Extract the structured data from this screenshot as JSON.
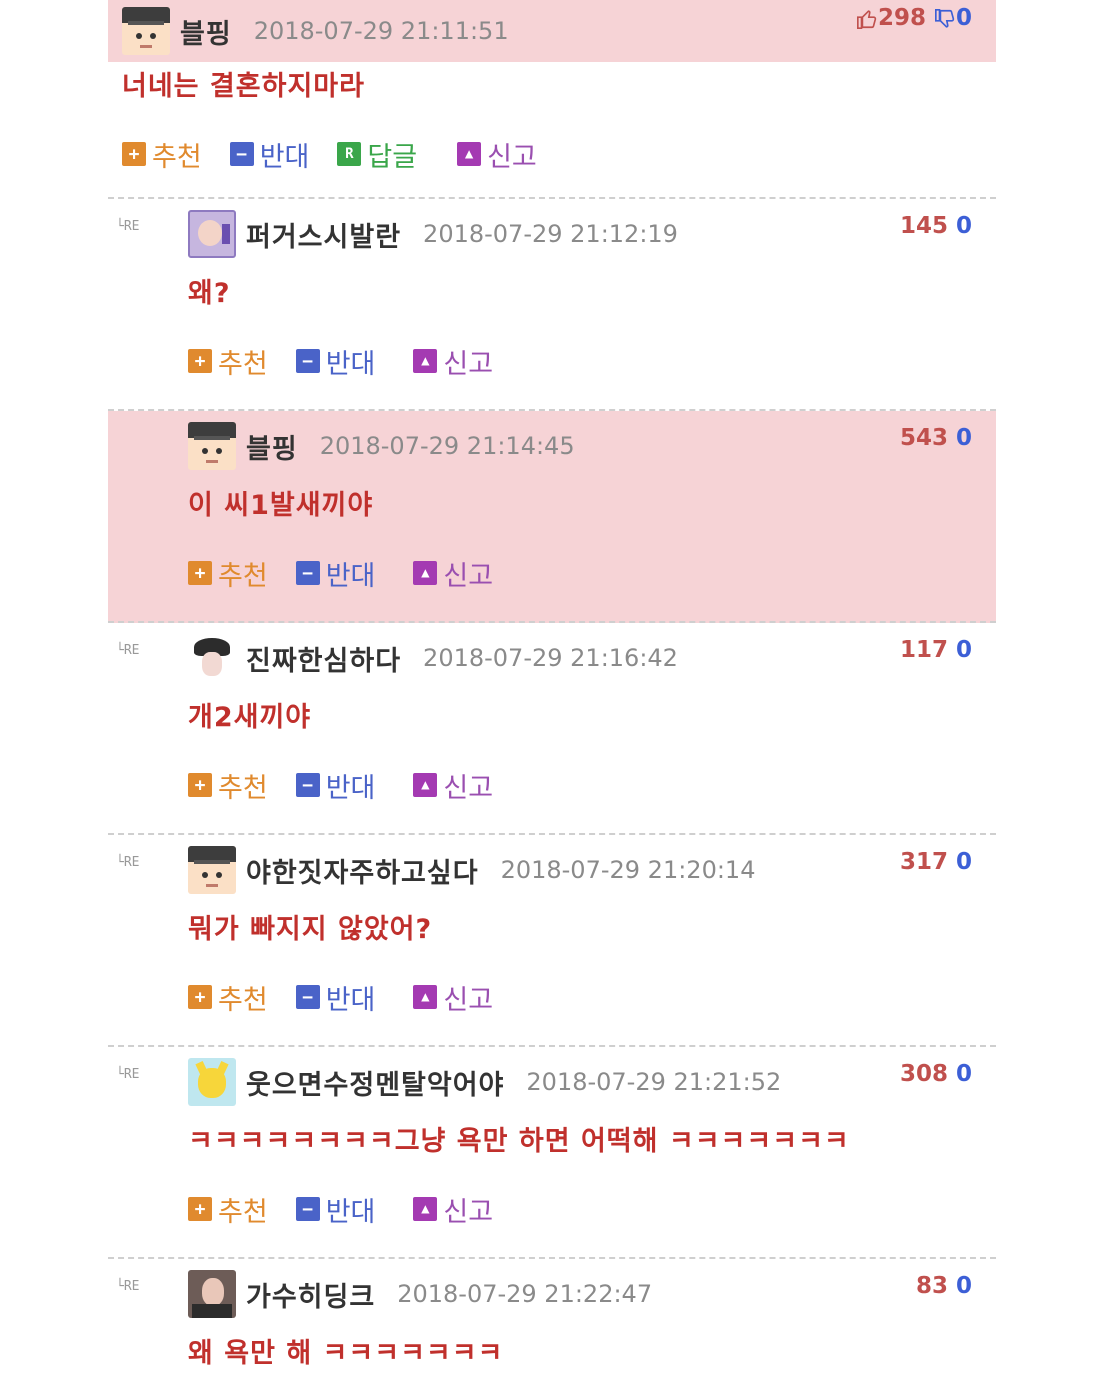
{
  "comments": [
    {
      "author": "블핑",
      "timestamp": "2018-07-29 21:11:51",
      "likes": "298",
      "dislikes": "0",
      "text": "너네는 결혼하지마라",
      "actions": {
        "up": "추천",
        "down": "반대",
        "reply": "답글",
        "report": "신고"
      },
      "reply_icon_glyph": "R",
      "avatar": "graduate-avatar"
    },
    {
      "re": "└RE",
      "author": "퍼거스시발란",
      "timestamp": "2018-07-29 21:12:19",
      "likes": "145",
      "dislikes": "0",
      "text": "왜?",
      "actions": {
        "up": "추천",
        "down": "반대",
        "report": "신고"
      }
    },
    {
      "re": "",
      "author": "블핑",
      "timestamp": "2018-07-29 21:14:45",
      "likes": "543",
      "dislikes": "0",
      "text": "이 씨1발새끼야",
      "actions": {
        "up": "추천",
        "down": "반대",
        "report": "신고"
      }
    },
    {
      "re": "└RE",
      "author": "진짜한심하다",
      "timestamp": "2018-07-29 21:16:42",
      "likes": "117",
      "dislikes": "0",
      "text": "개2새끼야",
      "actions": {
        "up": "추천",
        "down": "반대",
        "report": "신고"
      }
    },
    {
      "re": "└RE",
      "author": "야한짓자주하고싶다",
      "timestamp": "2018-07-29 21:20:14",
      "likes": "317",
      "dislikes": "0",
      "text": "뭐가 빠지지 않았어?",
      "actions": {
        "up": "추천",
        "down": "반대",
        "report": "신고"
      }
    },
    {
      "re": "└RE",
      "author": "웃으면수정멘탈악어야",
      "timestamp": "2018-07-29 21:21:52",
      "likes": "308",
      "dislikes": "0",
      "text": "ㅋㅋㅋㅋㅋㅋㅋㅋ그냥 욕만 하면 어떡해 ㅋㅋㅋㅋㅋㅋㅋ",
      "actions": {
        "up": "추천",
        "down": "반대",
        "report": "신고"
      }
    },
    {
      "re": "└RE",
      "author": "가수히딩크",
      "timestamp": "2018-07-29 21:22:47",
      "likes": "83",
      "dislikes": "0",
      "text": "왜 욕만 해 ㅋㅋㅋㅋㅋㅋㅋ"
    }
  ],
  "colors": {
    "highlight_bg": "#f6d3d6",
    "comment_text": "#c0302c",
    "like": "#c0504d",
    "dislike": "#3c5fd6"
  }
}
